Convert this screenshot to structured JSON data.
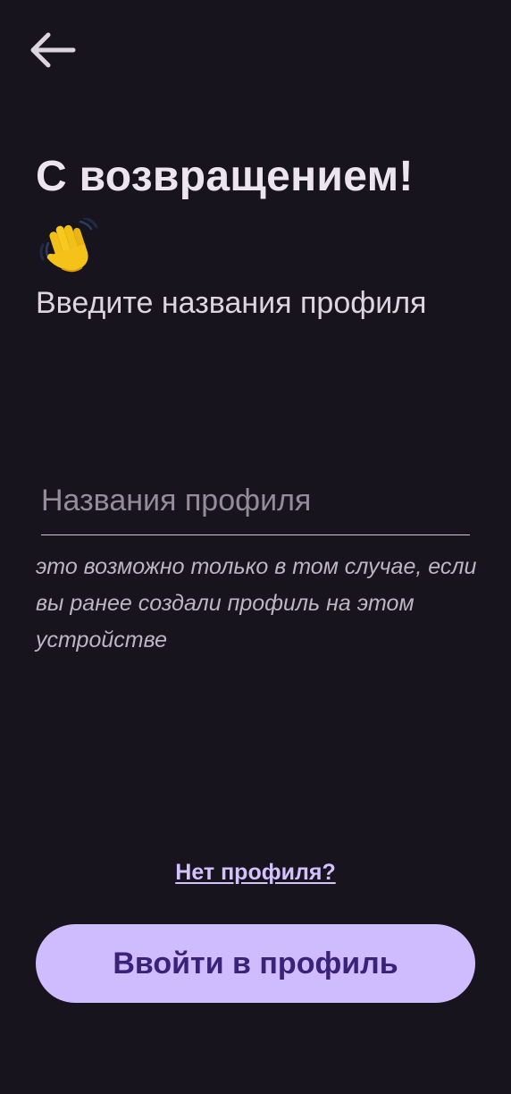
{
  "header": {
    "back_icon": "arrow-left-icon"
  },
  "greeting": {
    "title": "С возвращением!",
    "emoji_icon": "waving-hand-icon",
    "subtitle": "Введите названия профиля"
  },
  "form": {
    "profile_name": {
      "value": "",
      "placeholder": "Названия профиля"
    },
    "hint": "это возможно только в том случае, если вы ранее создали профиль на этом устройстве"
  },
  "footer": {
    "no_profile_link": "Нет профиля?",
    "login_button": "Ввойти в профиль"
  },
  "colors": {
    "background": "#17141d",
    "text_primary": "#ece5ef",
    "hint_text": "#bdb5c2",
    "accent_button": "#cfbcff",
    "button_text": "#3a2278",
    "link": "#d4c2ff"
  }
}
